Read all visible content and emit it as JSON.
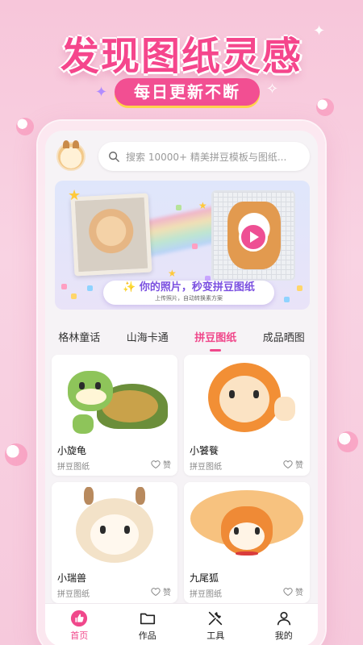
{
  "promo": {
    "headline": "发现图纸灵感",
    "subline": "每日更新不断"
  },
  "search": {
    "placeholder": "搜索 10000+ 精美拼豆模板与图纸..."
  },
  "banner": {
    "title": "✨ 你的照片，秒变拼豆图纸",
    "subtitle": "上传照片，自动转换素方案"
  },
  "tabs": [
    {
      "label": "格林童话",
      "active": false
    },
    {
      "label": "山海卡通",
      "active": false
    },
    {
      "label": "拼豆图纸",
      "active": true
    },
    {
      "label": "成品晒图",
      "active": false
    }
  ],
  "cards": [
    {
      "title": "小旋龟",
      "category": "拼豆图纸",
      "like_label": "赞"
    },
    {
      "title": "小饕餮",
      "category": "拼豆图纸",
      "like_label": "赞"
    },
    {
      "title": "小瑞兽",
      "category": "拼豆图纸",
      "like_label": "赞"
    },
    {
      "title": "九尾狐",
      "category": "拼豆图纸",
      "like_label": "赞"
    }
  ],
  "nav": [
    {
      "label": "首页",
      "icon": "thumbs-up-icon",
      "active": true
    },
    {
      "label": "作品",
      "icon": "folder-icon",
      "active": false
    },
    {
      "label": "工具",
      "icon": "tools-icon",
      "active": false
    },
    {
      "label": "我的",
      "icon": "person-icon",
      "active": false
    }
  ],
  "colors": {
    "accent": "#f0488b",
    "background": "#f9d3e3",
    "banner_text": "#7a4fe0"
  }
}
